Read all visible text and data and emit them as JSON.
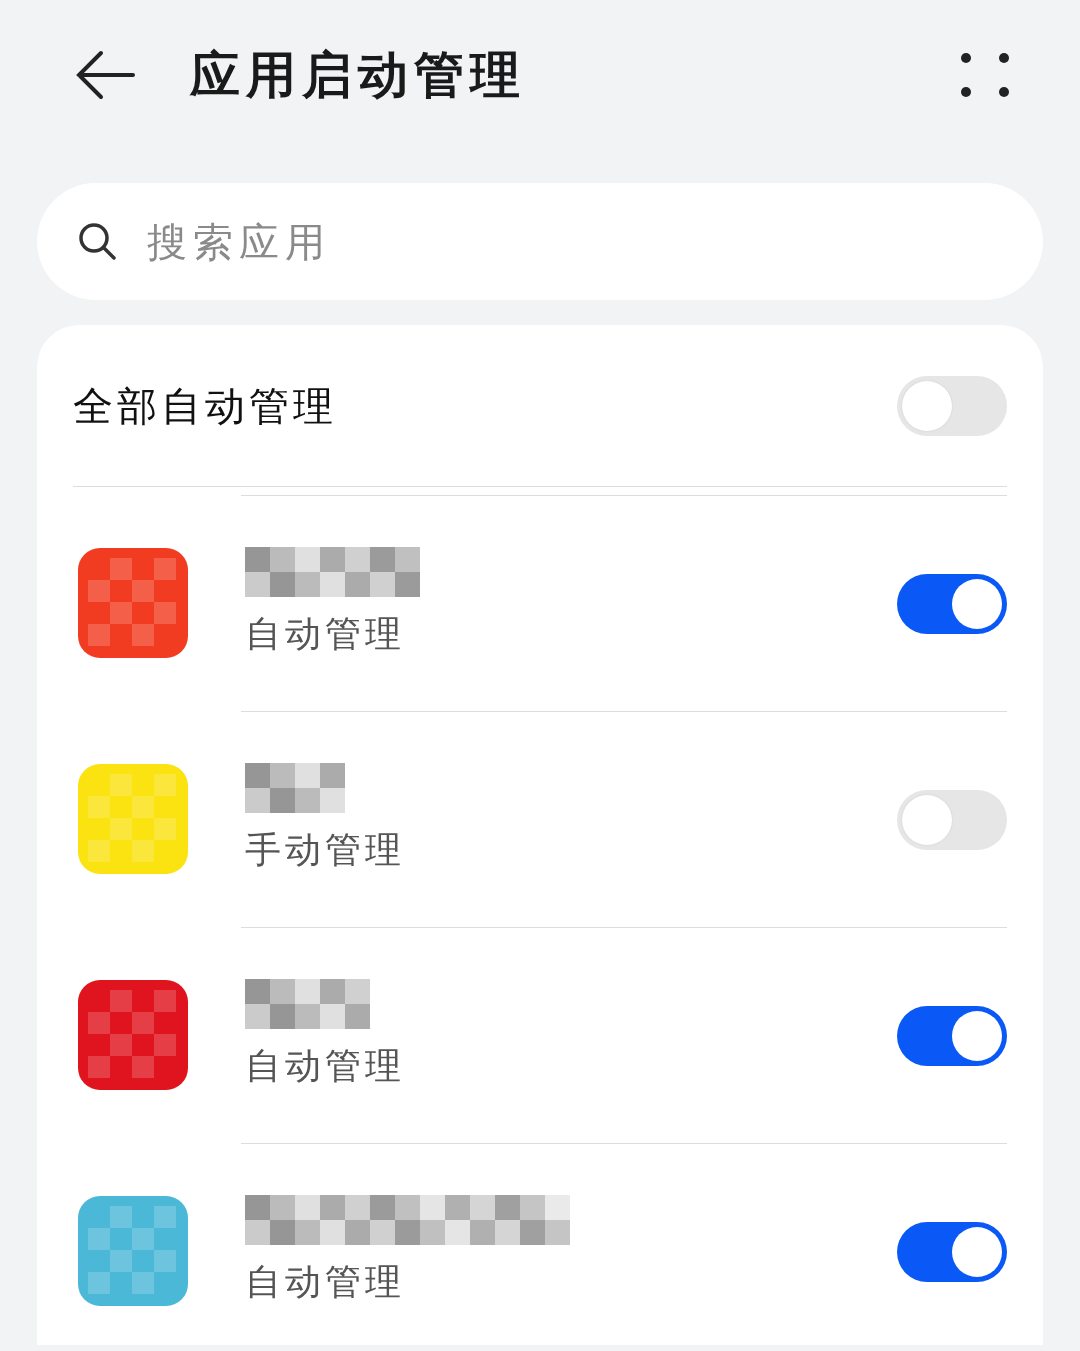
{
  "header": {
    "title": "应用启动管理"
  },
  "search": {
    "placeholder": "搜索应用"
  },
  "master": {
    "label": "全部自动管理",
    "on": false
  },
  "apps": [
    {
      "color": "#f23c22",
      "status": "自动管理",
      "on": true
    },
    {
      "color": "#fbe211",
      "status": "手动管理",
      "on": false
    },
    {
      "color": "#e0141e",
      "status": "自动管理",
      "on": true
    },
    {
      "color": "#4cb8d8",
      "status": "自动管理",
      "on": true
    }
  ]
}
